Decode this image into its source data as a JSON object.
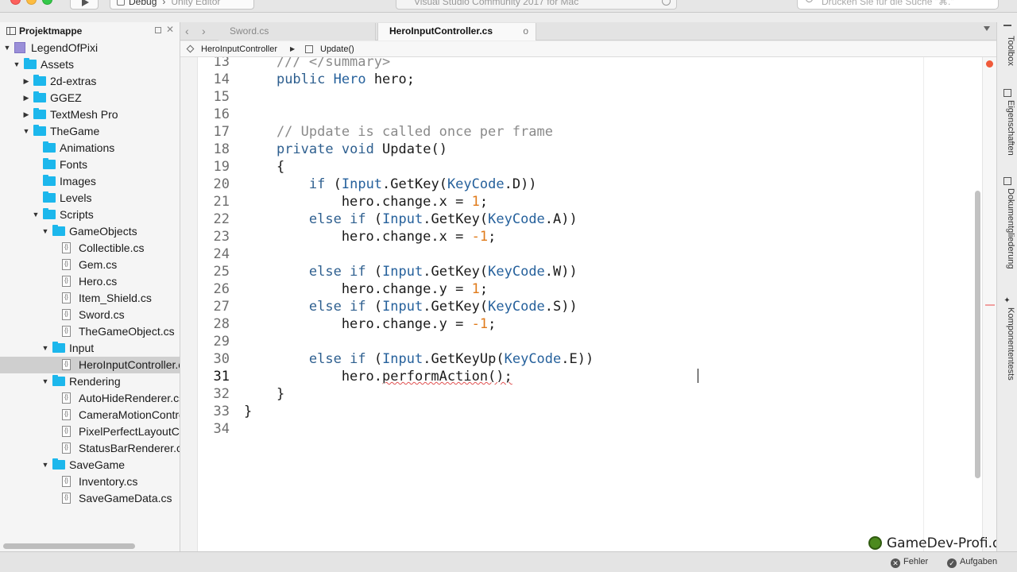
{
  "toolbar": {
    "configuration": "Debug",
    "target": "Unity Editor",
    "status_text": "Visual Studio Community 2017 for Mac",
    "search_placeholder": "Drücken Sie für die Suche \"⌘.\""
  },
  "solution_pad": {
    "title": "Projektmappe",
    "items": [
      {
        "label": "LegendOfPixi",
        "depth": 0,
        "type": "solution",
        "expanded": true
      },
      {
        "label": "Assets",
        "depth": 1,
        "type": "folder",
        "expanded": true
      },
      {
        "label": "2d-extras",
        "depth": 2,
        "type": "folder",
        "expanded": false
      },
      {
        "label": "GGEZ",
        "depth": 2,
        "type": "folder",
        "expanded": false
      },
      {
        "label": "TextMesh Pro",
        "depth": 2,
        "type": "folder",
        "expanded": false
      },
      {
        "label": "TheGame",
        "depth": 2,
        "type": "folder",
        "expanded": true
      },
      {
        "label": "Animations",
        "depth": 3,
        "type": "folder"
      },
      {
        "label": "Fonts",
        "depth": 3,
        "type": "folder"
      },
      {
        "label": "Images",
        "depth": 3,
        "type": "folder"
      },
      {
        "label": "Levels",
        "depth": 3,
        "type": "folder"
      },
      {
        "label": "Scripts",
        "depth": 3,
        "type": "folder",
        "expanded": true
      },
      {
        "label": "GameObjects",
        "depth": 4,
        "type": "folder",
        "expanded": true
      },
      {
        "label": "Collectible.cs",
        "depth": 5,
        "type": "file"
      },
      {
        "label": "Gem.cs",
        "depth": 5,
        "type": "file"
      },
      {
        "label": "Hero.cs",
        "depth": 5,
        "type": "file"
      },
      {
        "label": "Item_Shield.cs",
        "depth": 5,
        "type": "file"
      },
      {
        "label": "Sword.cs",
        "depth": 5,
        "type": "file"
      },
      {
        "label": "TheGameObject.cs",
        "depth": 5,
        "type": "file"
      },
      {
        "label": "Input",
        "depth": 4,
        "type": "folder",
        "expanded": true
      },
      {
        "label": "HeroInputController.cs",
        "depth": 5,
        "type": "file",
        "selected": true
      },
      {
        "label": "Rendering",
        "depth": 4,
        "type": "folder",
        "expanded": true
      },
      {
        "label": "AutoHideRenderer.cs",
        "depth": 5,
        "type": "file"
      },
      {
        "label": "CameraMotionController.cs",
        "depth": 5,
        "type": "file"
      },
      {
        "label": "PixelPerfectLayoutController.cs",
        "depth": 5,
        "type": "file"
      },
      {
        "label": "StatusBarRenderer.cs",
        "depth": 5,
        "type": "file"
      },
      {
        "label": "SaveGame",
        "depth": 4,
        "type": "folder",
        "expanded": true
      },
      {
        "label": "Inventory.cs",
        "depth": 5,
        "type": "file"
      },
      {
        "label": "SaveGameData.cs",
        "depth": 5,
        "type": "file"
      }
    ]
  },
  "tabs": [
    {
      "label": "Sword.cs",
      "active": false
    },
    {
      "label": "HeroInputController.cs",
      "active": true,
      "modified_marker": "o"
    }
  ],
  "breadcrumb": {
    "class_name": "HeroInputController",
    "separator": "▶",
    "method_name": "Update()"
  },
  "editor": {
    "current_line": 31,
    "lines": [
      {
        "n": 13,
        "code": "    /// </summary>"
      },
      {
        "n": 14,
        "code": "    public Hero hero;"
      },
      {
        "n": 15,
        "code": ""
      },
      {
        "n": 16,
        "code": ""
      },
      {
        "n": 17,
        "code": "    // Update is called once per frame"
      },
      {
        "n": 18,
        "code": "    private void Update()"
      },
      {
        "n": 19,
        "code": "    {"
      },
      {
        "n": 20,
        "code": "        if (Input.GetKey(KeyCode.D))"
      },
      {
        "n": 21,
        "code": "            hero.change.x = 1;"
      },
      {
        "n": 22,
        "code": "        else if (Input.GetKey(KeyCode.A))"
      },
      {
        "n": 23,
        "code": "            hero.change.x = -1;"
      },
      {
        "n": 24,
        "code": ""
      },
      {
        "n": 25,
        "code": "        else if (Input.GetKey(KeyCode.W))"
      },
      {
        "n": 26,
        "code": "            hero.change.y = 1;"
      },
      {
        "n": 27,
        "code": "        else if (Input.GetKey(KeyCode.S))"
      },
      {
        "n": 28,
        "code": "            hero.change.y = -1;"
      },
      {
        "n": 29,
        "code": ""
      },
      {
        "n": 30,
        "code": "        else if (Input.GetKeyUp(KeyCode.E))"
      },
      {
        "n": 31,
        "code": "            hero.performAction();"
      },
      {
        "n": 32,
        "code": "    }"
      },
      {
        "n": 33,
        "code": "}"
      },
      {
        "n": 34,
        "code": ""
      }
    ]
  },
  "right_dock": {
    "items": [
      "Toolbox",
      "Eigenschaften",
      "Dokumentgliederung",
      "Komponententests"
    ]
  },
  "watermark": "GameDev-Profi.de",
  "status": {
    "errors_label": "Fehler",
    "tasks_label": "Aufgaben"
  },
  "colors": {
    "keyword": "#2e5f8f",
    "type": "#26619c",
    "comment": "#8a8a8a",
    "number": "#e07a1a",
    "folder": "#1cb7ec",
    "selection": "#cfcfcf"
  }
}
